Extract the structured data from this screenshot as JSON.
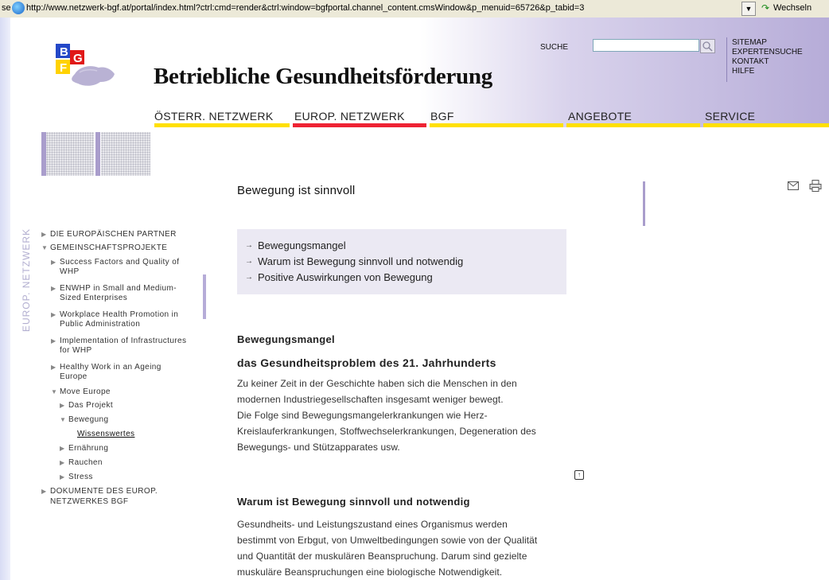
{
  "browser": {
    "address_prefix": "se",
    "url": "http://www.netzwerk-bgf.at/portal/index.html?ctrl:cmd=render&ctrl:window=bgfportal.channel_content.cmsWindow&p_menuid=65726&p_tabid=3",
    "dropdown_glyph": "▼",
    "go_label": "Wechseln"
  },
  "header": {
    "logo_letters": [
      "B",
      "G",
      "F"
    ],
    "site_title": "Betriebliche Gesundheitsförderung",
    "search": {
      "label": "SUCHE",
      "value": "",
      "placeholder": ""
    },
    "top_links": [
      "SITEMAP",
      "EXPERTENSUCHE",
      "KONTAKT",
      "HILFE"
    ],
    "nav": [
      {
        "label": "ÖSTERR. NETZWERK",
        "bar_color": "#ffe000"
      },
      {
        "label": "EUROP. NETZWERK",
        "bar_color": "#ee2233",
        "active": true
      },
      {
        "label": "BGF",
        "bar_color": "#ffe000"
      },
      {
        "label": "ANGEBOTE",
        "bar_color": "#ffe000"
      },
      {
        "label": "SERVICE",
        "bar_color": "#ffe000"
      }
    ]
  },
  "sidebar": {
    "section_label": "EUROP. NETZWERK",
    "items": [
      {
        "label": "DIE EUROPÄISCHEN PARTNER"
      },
      {
        "label": "GEMEINSCHAFTSPROJEKTE"
      },
      {
        "label": "Success Factors and Quality of"
      },
      {
        "label": "WHP"
      },
      {
        "label": "ENWHP in Small and Medium-"
      },
      {
        "label": "Sized Enterprises"
      },
      {
        "label": "Workplace Health Promotion in"
      },
      {
        "label": "Public Administration"
      },
      {
        "label": "Implementation of Infrastructures"
      },
      {
        "label": "for WHP"
      },
      {
        "label": "Healthy Work in an Ageing"
      },
      {
        "label": "Europe"
      },
      {
        "label": "Move Europe"
      },
      {
        "label": "Das Projekt"
      },
      {
        "label": "Bewegung"
      },
      {
        "label": "Wissenswertes"
      },
      {
        "label": "Ernährung"
      },
      {
        "label": "Rauchen"
      },
      {
        "label": "Stress"
      },
      {
        "label": "DOKUMENTE DES EUROP."
      },
      {
        "label": "NETZWERKES BGF"
      }
    ]
  },
  "content": {
    "title": "Bewegung ist sinnvoll",
    "toc": [
      "Bewegungsmangel",
      "Warum ist Bewegung sinnvoll und notwendig",
      "Positive Auswirkungen von Bewegung"
    ],
    "sections": [
      {
        "heading": "Bewegungsmangel",
        "subheading": "das Gesundheitsproblem des 21. Jahrhunderts",
        "lines": [
          "Zu keiner Zeit in der Geschichte haben sich die Menschen in den",
          "modernen Industriegesellschaften insgesamt weniger bewegt.",
          "Die Folge sind Bewegungsmangelerkrankungen wie Herz-",
          "Kreislauferkrankungen, Stoffwechselerkrankungen, Degeneration des",
          "Bewegungs- und Stützapparates usw."
        ]
      },
      {
        "heading": "Warum ist Bewegung sinnvoll und notwendig",
        "lines": [
          "Gesundheits- und Leistungszustand eines Organismus werden",
          "bestimmt von Erbgut, von Umweltbedingungen sowie von der Qualität",
          "und Quantität der muskulären Beanspruchung. Darum sind gezielte",
          "muskuläre Beanspruchungen eine biologische Notwendigkeit."
        ]
      }
    ],
    "top_glyph": "↑"
  },
  "colors": {
    "nav_yellow": "#ffe000",
    "nav_active_red": "#ee2233",
    "accent_lilac": "#a99dcc"
  },
  "icons": [
    "ie-page-icon",
    "search-icon",
    "mail-icon",
    "print-icon",
    "back-to-top-icon"
  ]
}
